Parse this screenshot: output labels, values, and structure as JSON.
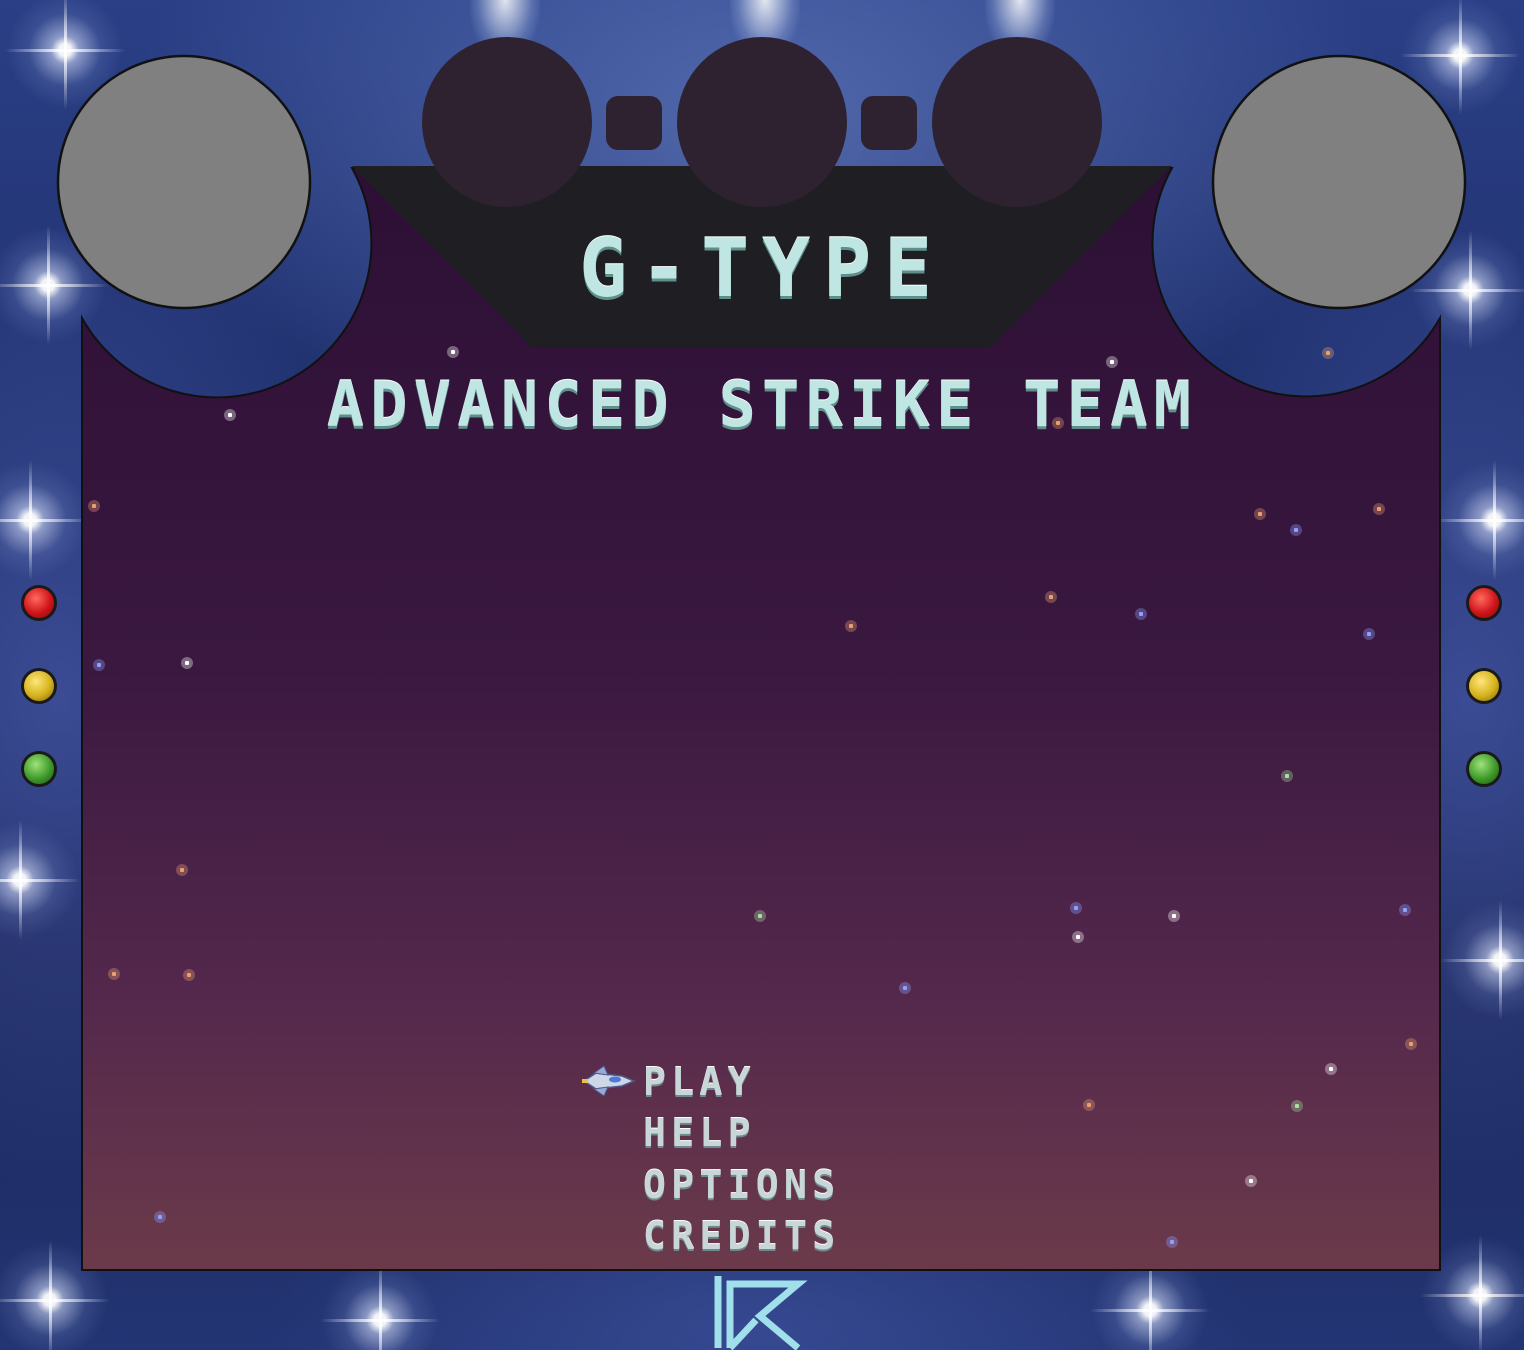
{
  "game": {
    "title": "G-TYPE",
    "subtitle": "ADVANCED STRIKE TEAM"
  },
  "menu": {
    "items": [
      {
        "label": "PLAY",
        "selected": true
      },
      {
        "label": "HELP",
        "selected": false
      },
      {
        "label": "OPTIONS",
        "selected": false
      },
      {
        "label": "CREDITS",
        "selected": false
      }
    ],
    "cursor_icon": "spaceship-icon"
  },
  "cabinet": {
    "indicator_lights": [
      "red",
      "yellow",
      "green"
    ],
    "colors": {
      "screen_top": "#2d0f35",
      "screen_bottom": "#6b3a4a",
      "title_panel": "#1f1e22",
      "top_circles": "#2f2230",
      "corner_circles": "#808080",
      "frame": "#233574",
      "text": "#bfe6e2",
      "light_red": "#d0141a",
      "light_yellow": "#d4b21c",
      "light_green": "#3f9a2a"
    },
    "logo_icon": "studio-logo-icon"
  }
}
